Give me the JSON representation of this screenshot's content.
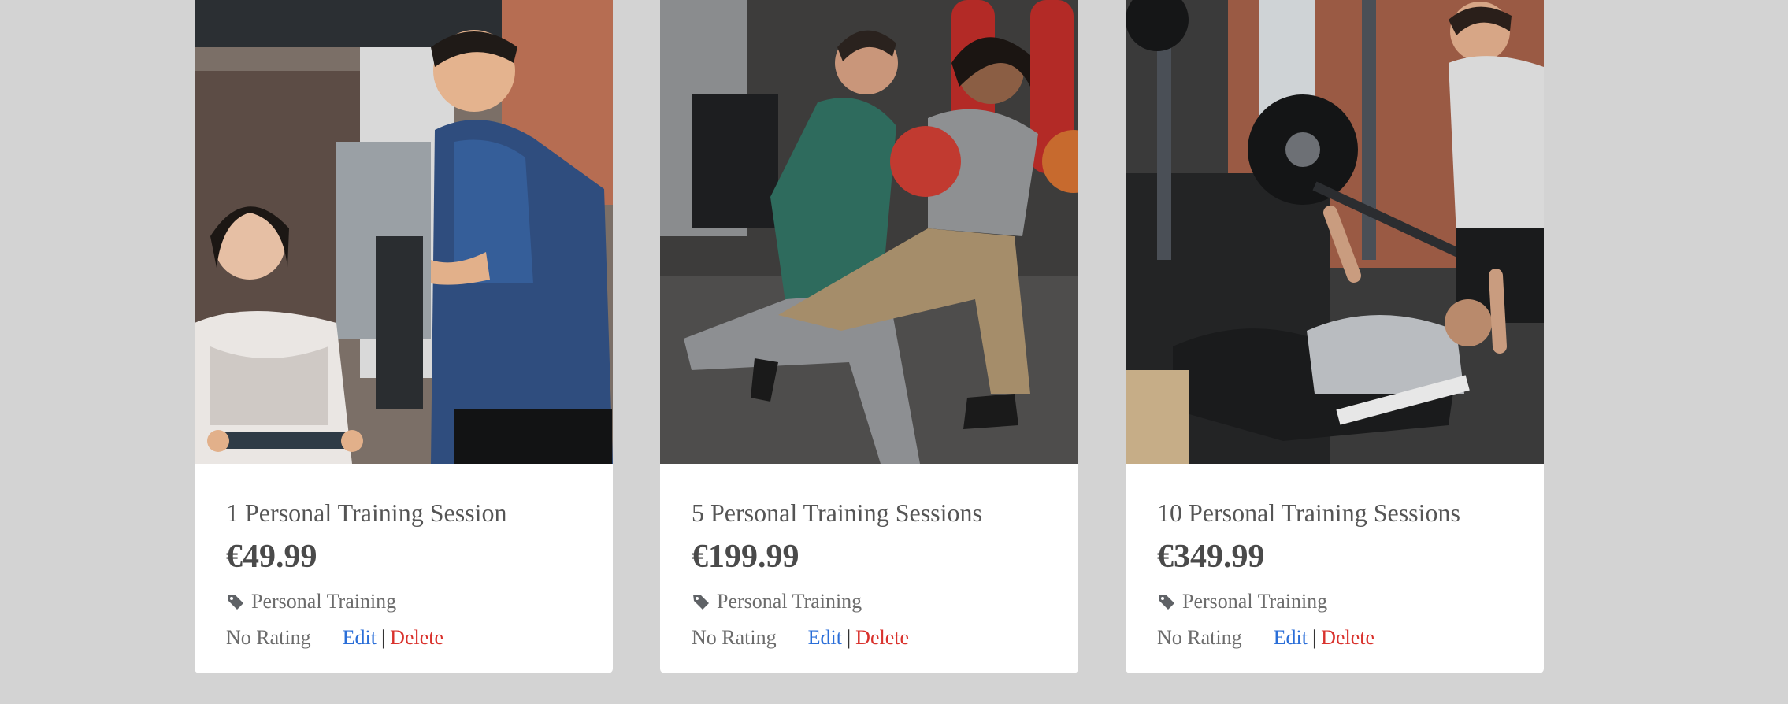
{
  "products": [
    {
      "photo_alt": "trainer-coaching-client-on-rowing-machine",
      "title": "1 Personal Training Session",
      "price": "€49.99",
      "category": "Personal Training",
      "rating": "No Rating",
      "edit_label": "Edit",
      "separator": "|",
      "delete_label": "Delete"
    },
    {
      "photo_alt": "two-people-training-with-medicine-balls",
      "title": "5 Personal Training Sessions",
      "price": "€199.99",
      "category": "Personal Training",
      "rating": "No Rating",
      "edit_label": "Edit",
      "separator": "|",
      "delete_label": "Delete"
    },
    {
      "photo_alt": "trainer-spotting-bench-press",
      "title": "10 Personal Training Sessions",
      "price": "€349.99",
      "category": "Personal Training",
      "rating": "No Rating",
      "edit_label": "Edit",
      "separator": "|",
      "delete_label": "Delete"
    }
  ],
  "colors": {
    "page_background": "#d3d3d3",
    "card_background": "#ffffff",
    "edit_link": "#2a6ed8",
    "delete_link": "#d9322d",
    "text_muted": "#6c6c6c"
  },
  "icons": {
    "category_icon": "tag-icon"
  }
}
